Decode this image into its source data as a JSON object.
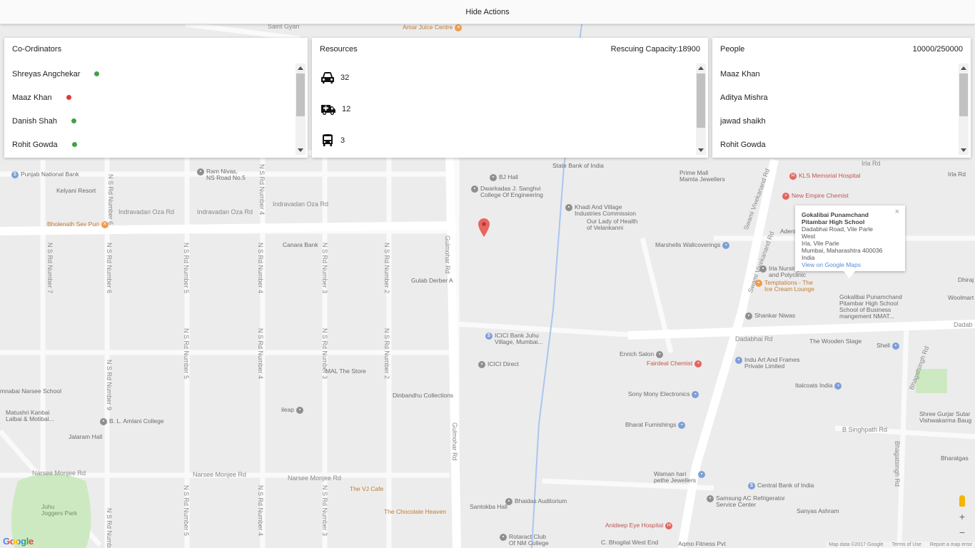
{
  "topbar": {
    "hide_actions_label": "Hide Actions"
  },
  "coordinators": {
    "title": "Co-Ordinators",
    "items": [
      {
        "name": "Shreyas Angchekar",
        "status_color": "#43a047"
      },
      {
        "name": "Maaz Khan",
        "status_color": "#e53935"
      },
      {
        "name": "Danish Shah",
        "status_color": "#43a047"
      },
      {
        "name": "Rohit Gowda",
        "status_color": "#43a047"
      }
    ]
  },
  "resources": {
    "title": "Resources",
    "capacity_text": "Rescuing Capacity:18900",
    "items": [
      {
        "icon": "car-icon",
        "count": "32"
      },
      {
        "icon": "ambulance-icon",
        "count": "12"
      },
      {
        "icon": "bus-icon",
        "count": "3"
      }
    ]
  },
  "people": {
    "title": "People",
    "count_text": "10000/250000",
    "items": [
      "Maaz Khan",
      "Aditya Mishra",
      "jawad shaikh",
      "Rohit Gowda"
    ]
  },
  "map": {
    "road_labels": {
      "indravadan_1": "Indravadan Oza Rd",
      "indravadan_2": "Indravadan Oza Rd",
      "indravadan_3": "Indravadan Oza Rd",
      "gulmohar_1": "Gulmohar Rd",
      "gulmohar_2": "Gulmohar Rd",
      "dadabhai": "Dadabhai Rd",
      "dadabhai_2": "Dadab",
      "narsee_1": "Narsee Monjee Rd",
      "narsee_2": "Narsee Monjee Rd",
      "narsee_3": "Narsee Monjee Rd",
      "swami_1": "Swami Vivekanand Rd",
      "swami_2": "Swami Vivekanand Rd",
      "bhagatsingh_1": "Bhagatsingh Rd",
      "bhagatsingh_2": "Bhagatsingh Rd",
      "singhpath": "B Singhpath Rd",
      "irla": "Irla Rd",
      "irla_2": "Irla Rd",
      "ns6": "N S Rd Number 6",
      "ns4": "N S Rd Number 4",
      "ns7": "N S Rd Number 7",
      "ns6b": "N S Rd Number 6",
      "ns5": "N S Rd Number 5",
      "ns4b": "N S Rd Number 4",
      "ns3": "N S Rd Number 3",
      "ns2": "N S Rd Number 2",
      "ns9": "N S Rd Number 9",
      "ns5b": "N S Rd Number 5",
      "ns4c": "N S Rd Number 4",
      "ns3b": "N S Rd Number 3",
      "ns2b": "N S Rd Number 2",
      "ns10": "N S Rd Number 10",
      "ns5c": "N S Rd Number 5",
      "ns4d": "N S Rd Number 4",
      "ns3c": "N S Rd Number 3",
      "saint_gyan": "Saint Gyan",
      "ns_top": "N S"
    },
    "pois": [
      {
        "label": "Amar Juice Centre",
        "color": "orange",
        "icon": "restaurant-icon"
      },
      {
        "label": "Punjab National Bank",
        "color": "blue",
        "icon": "bank-icon"
      },
      {
        "label": "Kelyani Resort",
        "color": "gray",
        "icon": "hotel-icon"
      },
      {
        "label": "Bholenath Sev Puri",
        "color": "orange",
        "icon": "restaurant-icon"
      },
      {
        "label": "Ram Nivas,\nNS Road No.5",
        "color": "gray",
        "icon": "building-icon"
      },
      {
        "label": "Canara Bank",
        "color": "blue",
        "icon": "bank-icon"
      },
      {
        "label": "BJ Hall",
        "color": "brown",
        "icon": "hall-icon"
      },
      {
        "label": "Dwarkadas J. Sanghvi\nCollege Of Engineering",
        "color": "brown",
        "icon": "school-icon"
      },
      {
        "label": "State Bank of India",
        "color": "blue",
        "icon": "bank-icon"
      },
      {
        "label": "Khadi And Village\nIndustries Commission",
        "color": "gray",
        "icon": "building-icon"
      },
      {
        "label": "Our Lady of Health\nof Velankanni",
        "color": "gray",
        "icon": "church-icon"
      },
      {
        "label": "Prime Mall\nMamta Jewellers",
        "color": "blue",
        "icon": "shopping-icon"
      },
      {
        "label": "KLS Memorial Hospital",
        "color": "red",
        "icon": "hospital-icon"
      },
      {
        "label": "New Empire Chemist",
        "color": "red",
        "icon": "pharmacy-icon"
      },
      {
        "label": "Marshells Wallcoverings",
        "color": "blue",
        "icon": "shopping-icon"
      },
      {
        "label": "Irla Nursing\nand Polyclinic",
        "color": "gray",
        "icon": "building-icon"
      },
      {
        "label": "Temptations - The\nIce Cream Lounge",
        "color": "orange",
        "icon": "cafe-icon"
      },
      {
        "label": "Gokalibai Punamchand\nPitambar High School\nSchool of Business\nmangement NMAT...",
        "color": "gray",
        "icon": "school-icon"
      },
      {
        "label": "Shankar Niwas",
        "color": "gray",
        "icon": "building-icon"
      },
      {
        "label": "Gulab Derber A",
        "color": "gray",
        "icon": ""
      },
      {
        "label": "ICICI Bank Juhu\nVillage, Mumbai...",
        "color": "blue",
        "icon": "bank-icon"
      },
      {
        "label": "ICICI Direct",
        "color": "gray",
        "icon": "building-icon"
      },
      {
        "label": "MAL The Store",
        "color": "blue",
        "icon": "shopping-icon"
      },
      {
        "label": "Dinbandhu Collections",
        "color": "blue",
        "icon": "shopping-icon"
      },
      {
        "label": "ileap",
        "color": "gray",
        "icon": "building-icon"
      },
      {
        "label": "Enrich Salon",
        "color": "gray",
        "icon": "salon-icon"
      },
      {
        "label": "Fairdeal Chemist",
        "color": "red",
        "icon": "pharmacy-icon"
      },
      {
        "label": "Indu Art And Frames\nPrivate Limited",
        "color": "blue",
        "icon": "shopping-icon"
      },
      {
        "label": "The Wooden Stage",
        "color": "gray",
        "icon": "building-icon"
      },
      {
        "label": "Shell",
        "color": "blue",
        "icon": "gas-icon"
      },
      {
        "label": "Sony Mony Electronics",
        "color": "blue",
        "icon": "shopping-icon"
      },
      {
        "label": "Italcoats India",
        "color": "blue",
        "icon": "shopping-icon"
      },
      {
        "label": "Bharat Furnishings",
        "color": "blue",
        "icon": "shopping-icon"
      },
      {
        "label": "Shree Gurjar Sutar\nVishwakarma Baug",
        "color": "gray",
        "icon": "building-icon"
      },
      {
        "label": "Bharatgas",
        "color": "gray",
        "icon": "building-icon"
      },
      {
        "label": "Bhaidas Auditorium",
        "color": "gray",
        "icon": "hall-icon"
      },
      {
        "label": "Santokba Hall",
        "color": "gray",
        "icon": "hall-icon"
      },
      {
        "label": "Waman hari\npethe Jewellers",
        "color": "blue",
        "icon": "shopping-icon"
      },
      {
        "label": "Central Bank of India",
        "color": "blue",
        "icon": "bank-icon"
      },
      {
        "label": "Samsung AC Refrigerator\nService Center",
        "color": "gray",
        "icon": "building-icon"
      },
      {
        "label": "Sanyas Ashram",
        "color": "gray",
        "icon": "building-icon"
      },
      {
        "label": "Anideep Eye Hospital",
        "color": "red",
        "icon": "hospital-icon"
      },
      {
        "label": "C. Bhogilal West End",
        "color": "blue",
        "icon": "shopping-icon"
      },
      {
        "label": "Rotaract Club\nOf NM College",
        "color": "gray",
        "icon": "building-icon"
      },
      {
        "label": "Aqmo Fitness Pvt",
        "color": "gray",
        "icon": "building-icon"
      },
      {
        "label": "The VJ Cafe",
        "color": "orange",
        "icon": "cafe-icon"
      },
      {
        "label": "The Chocolate Heaven",
        "color": "orange",
        "icon": "cafe-icon"
      },
      {
        "label": "Matushri Kanbai\nLalbai & Motibal...",
        "color": "gray",
        "icon": "school-icon"
      },
      {
        "label": "B. L. Amlani College",
        "color": "gray",
        "icon": "school-icon"
      },
      {
        "label": "Jalaram Hall",
        "color": "gray",
        "icon": "hall-icon"
      },
      {
        "label": "mnabai Narsee School",
        "color": "gray",
        "icon": "school-icon"
      },
      {
        "label": "Juhu\nJoggers Park",
        "color": "gray",
        "icon": ""
      },
      {
        "label": "Adeni",
        "color": "gray",
        "icon": ""
      },
      {
        "label": "Irla Rd",
        "color": "gray",
        "icon": ""
      },
      {
        "label": "Dhiraj",
        "color": "gray",
        "icon": ""
      },
      {
        "label": "Woolmart",
        "color": "gray",
        "icon": ""
      }
    ],
    "info_window": {
      "title": "Gokalibai Punamchand\nPitambar High School",
      "address": "Dadabhai Road, Vile Parle\nWest\nIrla, Vile Parle\nMumbai, Maharashtra 400036\nIndia",
      "link": "View on Google Maps",
      "close": "×"
    },
    "google_logo": "Google",
    "footer": {
      "map_data": "Map data ©2017 Google",
      "terms": "Terms of Use",
      "report": "Report a map error"
    },
    "zoom_in": "+",
    "zoom_out": "−"
  }
}
